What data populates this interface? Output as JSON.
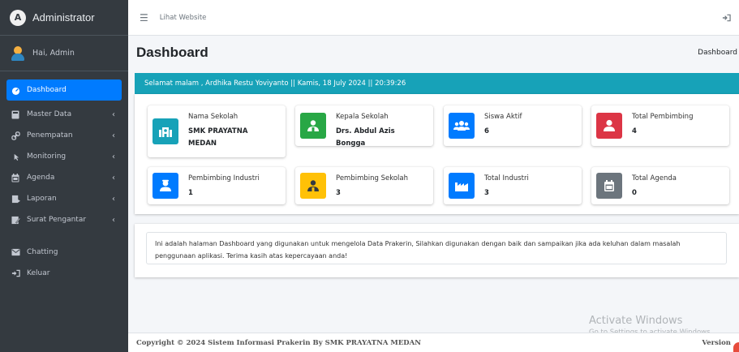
{
  "app": {
    "brand": "Administrator",
    "brand_logo_letter": "A"
  },
  "user": {
    "greeting": "Hai, Admin"
  },
  "sidebar": {
    "items": [
      {
        "label": "Dashboard",
        "icon": "dashboard-icon",
        "active": true
      },
      {
        "label": "Master Data",
        "icon": "database-icon",
        "chevron": "‹"
      },
      {
        "label": "Penempatan",
        "icon": "link-icon",
        "chevron": "‹"
      },
      {
        "label": "Monitoring",
        "icon": "pointer-icon",
        "chevron": "‹"
      },
      {
        "label": "Agenda",
        "icon": "calendar-icon",
        "chevron": "‹"
      },
      {
        "label": "Laporan",
        "icon": "report-icon",
        "chevron": "‹"
      },
      {
        "label": "Surat Pengantar",
        "icon": "letter-icon",
        "chevron": "‹"
      },
      {
        "label": "Chatting",
        "icon": "chat-icon"
      },
      {
        "label": "Keluar",
        "icon": "logout-icon"
      }
    ]
  },
  "topbar": {
    "link": "Lihat Website"
  },
  "page": {
    "title": "Dashboard",
    "breadcrumb": "Dashboard"
  },
  "greeting_bar": "Selamat malam , Ardhika Restu Yoviyanto || Kamis, 18 July 2024 || 20:39:26",
  "cards": [
    {
      "label": "Nama Sekolah",
      "value": "SMK PRAYATNA MEDAN",
      "color": "#17a2b8",
      "icon": "school-icon"
    },
    {
      "label": "Kepala Sekolah",
      "value": "Drs. Abdul Azis Bongga",
      "color": "#28a745",
      "icon": "principal-icon"
    },
    {
      "label": "Siswa Aktif",
      "value": "6",
      "color": "#007bff",
      "icon": "users-icon"
    },
    {
      "label": "Total Pembimbing",
      "value": "4",
      "color": "#dc3545",
      "icon": "user-icon"
    },
    {
      "label": "Pembimbing Industri",
      "value": "1",
      "color": "#007bff",
      "icon": "industry-mentor-icon"
    },
    {
      "label": "Pembimbing Sekolah",
      "value": "3",
      "color": "#ffc107",
      "icon": "school-mentor-icon"
    },
    {
      "label": "Total Industri",
      "value": "3",
      "color": "#007bff",
      "icon": "factory-icon"
    },
    {
      "label": "Total Agenda",
      "value": "0",
      "color": "#6c757d",
      "icon": "agenda-icon"
    }
  ],
  "info": "Ini adalah halaman Dashboard yang digunakan untuk mengelola Data Prakerin, Silahkan digunakan dengan baik dan sampaikan jika ada keluhan dalam masalah penggunaan aplikasi. Terima kasih atas kepercayaan anda!",
  "watermark": {
    "title": "Activate Windows",
    "subtitle": "Go to Settings to activate Windows."
  },
  "footer": {
    "copyright": "Copyright © 2024 Sistem Informasi Prakerin By SMK PRAYATNA MEDAN",
    "version": "Version"
  }
}
